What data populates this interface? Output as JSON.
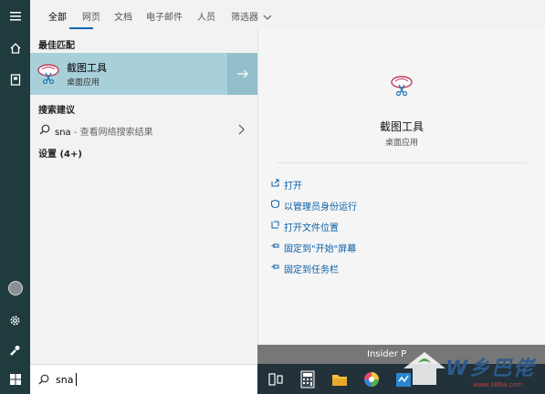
{
  "tabs": [
    {
      "label": "全部"
    },
    {
      "label": "网页"
    },
    {
      "label": "文档"
    },
    {
      "label": "电子邮件"
    },
    {
      "label": "人员"
    },
    {
      "label": "筛选器"
    }
  ],
  "results": {
    "best_match_heading": "最佳匹配",
    "best_match": {
      "title": "截图工具",
      "subtitle": "桌面应用"
    },
    "suggestions_heading": "搜索建议",
    "suggestion": {
      "query": "sna",
      "description": " - 查看网络搜索结果"
    },
    "settings_heading": "设置 (4+)"
  },
  "preview": {
    "title": "截图工具",
    "subtitle": "桌面应用",
    "actions": [
      {
        "label": "打开",
        "icon": "open-icon"
      },
      {
        "label": "以管理员身份运行",
        "icon": "shield-icon"
      },
      {
        "label": "打开文件位置",
        "icon": "folder-location-icon"
      },
      {
        "label": "固定到\"开始\"屏幕",
        "icon": "pin-icon"
      },
      {
        "label": "固定到任务栏",
        "icon": "pin-icon"
      }
    ]
  },
  "search": {
    "value": "sna"
  },
  "taskbar": {
    "insider_label": "Insider P"
  },
  "watermark": {
    "brand": "W乡巴佬",
    "url": "www.386w.com"
  },
  "colors": {
    "rail": "#1f3b3d",
    "highlight": "#a8d0da",
    "accent": "#0a67b2",
    "link": "#0a5fa8"
  }
}
